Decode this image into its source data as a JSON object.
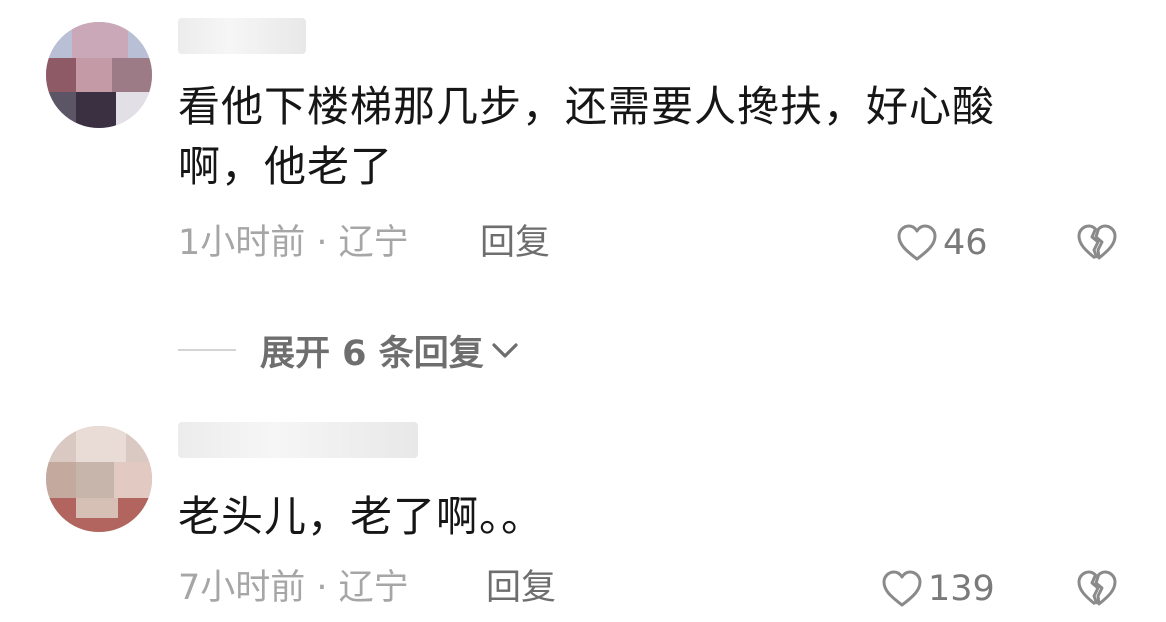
{
  "comments": [
    {
      "text_line1": "看他下楼梯那几步，还需要人搀扶，好心酸",
      "text_line2": "啊，他老了",
      "meta": "1小时前 · 辽宁",
      "reply_label": "回复",
      "likes": "46"
    },
    {
      "text_line1": "老头儿，老了啊。。",
      "meta": "7小时前 · 辽宁",
      "reply_label": "回复",
      "likes": "139"
    }
  ],
  "expand": {
    "label": "展开 6 条回复"
  },
  "icons": {
    "like": "heart-outline-icon",
    "dislike": "broken-heart-icon",
    "expand": "chevron-down-icon"
  },
  "colors": {
    "text": "#161616",
    "meta": "#a6a6a6",
    "action": "#6e6e6e"
  }
}
